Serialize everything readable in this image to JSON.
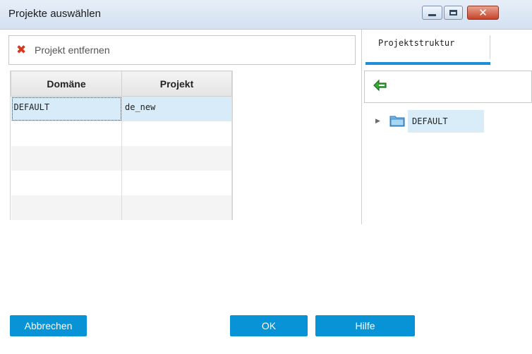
{
  "window": {
    "title": "Projekte auswählen",
    "controls": {
      "minimize": "minimize-icon",
      "maximize": "maximize-icon",
      "close": "close-icon"
    }
  },
  "toolbar": {
    "remove_label": "Projekt entfernen",
    "remove_icon": "red-x-icon"
  },
  "table": {
    "headers": [
      "Domäne",
      "Projekt"
    ],
    "rows": [
      [
        "DEFAULT",
        "de_new"
      ]
    ]
  },
  "right_panel": {
    "tab_label": "Projektstruktur",
    "back_icon": "green-back-arrow-icon",
    "tree": [
      {
        "label": "DEFAULT",
        "icon": "folder-icon",
        "expanded": false
      }
    ]
  },
  "buttons": {
    "cancel": "Abbrechen",
    "ok": "OK",
    "help": "Hilfe"
  },
  "colors": {
    "accent": "#0793d5",
    "selection": "#d7ebf8",
    "tab_underline": "#1e8fd6"
  }
}
